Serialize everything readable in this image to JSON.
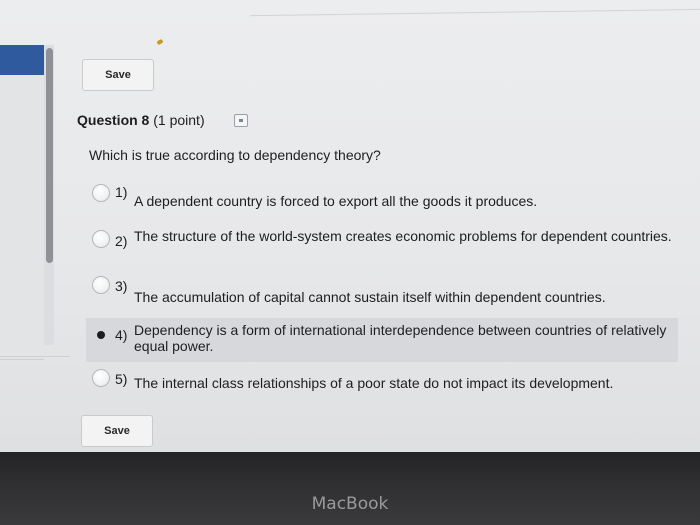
{
  "toolbar": {
    "save_label": "Save"
  },
  "question": {
    "title": "Question 8",
    "points": "(1 point)",
    "text": "Which is true according to dependency theory?",
    "options": [
      {
        "num": "1)",
        "text": "A dependent country is forced to export all the goods it produces.",
        "selected": false
      },
      {
        "num": "2)",
        "text": "The structure of the world-system creates economic problems for dependent countries.",
        "selected": false
      },
      {
        "num": "3)",
        "text": "The accumulation of capital cannot sustain itself within dependent countries.",
        "selected": false
      },
      {
        "num": "4)",
        "text": "Dependency is a form of international interdependence between countries of relatively equal power.",
        "selected": true
      },
      {
        "num": "5)",
        "text": "The internal class relationships of a poor state do not impact its development.",
        "selected": false
      }
    ]
  },
  "footer": {
    "save_label": "Save"
  },
  "device": {
    "brand": "MacBook"
  },
  "colors": {
    "accent": "#2f5a9e",
    "selected_bg": "#d6d8dc"
  },
  "icons": {
    "flag": "flag-question-icon"
  }
}
